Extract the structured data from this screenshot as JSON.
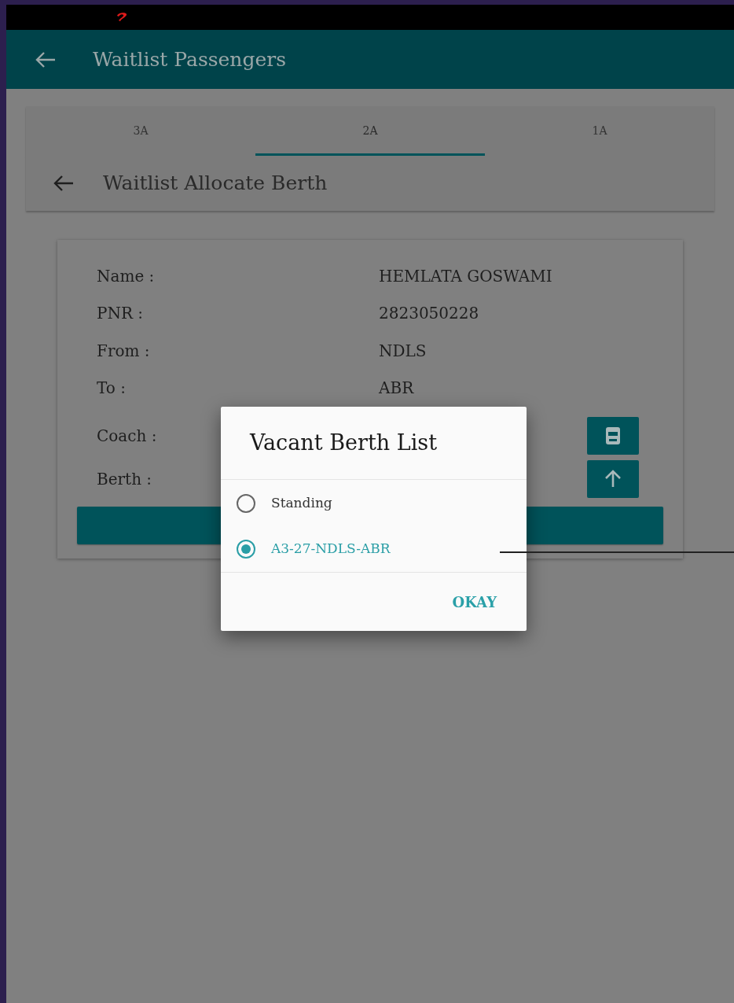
{
  "app_bar": {
    "title": "Waitlist Passengers"
  },
  "tabs": [
    {
      "label": "3A",
      "selected": false
    },
    {
      "label": "2A",
      "selected": true
    },
    {
      "label": "1A",
      "selected": false
    }
  ],
  "sub_header": {
    "title": "Waitlist Allocate Berth"
  },
  "details": [
    {
      "label": "Name :",
      "value": "HEMLATA GOSWAMI"
    },
    {
      "label": "PNR :",
      "value": "2823050228"
    },
    {
      "label": "From :",
      "value": "NDLS"
    },
    {
      "label": "To :",
      "value": "ABR"
    }
  ],
  "coach": {
    "label": "Coach :"
  },
  "berth": {
    "label": "Berth :"
  },
  "dialog": {
    "title": "Vacant Berth List",
    "options": [
      {
        "label": "Standing",
        "selected": false
      },
      {
        "label": "A3-27-NDLS-ABR",
        "selected": true
      }
    ],
    "button": "OKAY"
  }
}
